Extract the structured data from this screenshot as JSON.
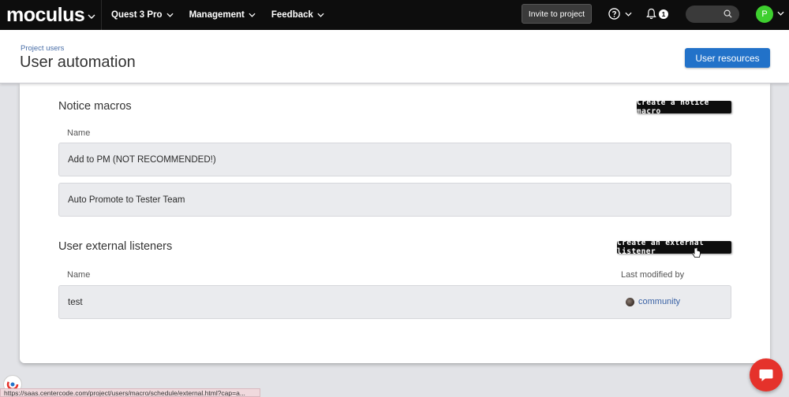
{
  "nav": {
    "logo": "moculus",
    "project": "Quest 3 Pro",
    "management": "Management",
    "feedback": "Feedback",
    "invite": "Invite to project",
    "notification_count": "1",
    "avatar_initial": "P"
  },
  "header": {
    "breadcrumb": "Project users",
    "title": "User automation",
    "resources_button": "User resources"
  },
  "notice_macros": {
    "title": "Notice macros",
    "create_button": "Create a notice macro",
    "column_name": "Name",
    "rows": [
      {
        "name": "Add to PM (NOT RECOMMENDED!)"
      },
      {
        "name": "Auto Promote to Tester Team"
      }
    ]
  },
  "external_listeners": {
    "title": "User external listeners",
    "create_button": "Create an external listener",
    "column_name": "Name",
    "column_modified": "Last modified by",
    "rows": [
      {
        "name": "test",
        "modified_by": "community"
      }
    ]
  },
  "status_bar": {
    "url": "https://saas.centercode.com/project/users/macro/schedule/external.html?cap=a..."
  },
  "colors": {
    "nav_bg": "#0d0d0d",
    "accent_blue": "#2272c9",
    "avatar_green": "#3ecf2f",
    "chat_red": "#e5322b"
  }
}
